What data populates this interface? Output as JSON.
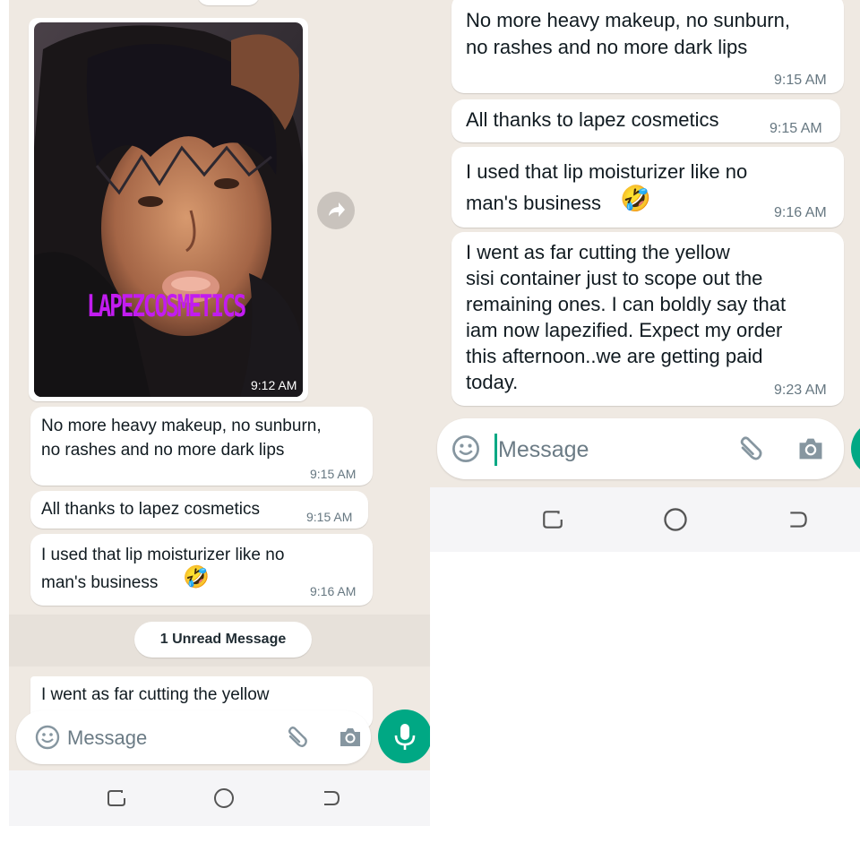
{
  "left": {
    "photo": {
      "watermark": "LAPEZCOSMETICS",
      "time": "9:12 AM"
    },
    "messages": [
      {
        "text": "No more heavy makeup, no sunburn,\nno rashes and no more dark lips",
        "time": "9:15 AM"
      },
      {
        "text": "All thanks to lapez cosmetics",
        "time": "9:15 AM"
      },
      {
        "text": "I used that lip moisturizer like no\nman's business",
        "time": "9:16 AM"
      }
    ],
    "unread_label": "1 Unread Message",
    "partial_message": "I went as far cutting the yellow",
    "input_placeholder": "Message"
  },
  "right": {
    "messages": [
      {
        "text": "No more heavy makeup, no sunburn,\nno rashes and no more dark lips",
        "time": "9:15 AM"
      },
      {
        "text": "All thanks to lapez cosmetics",
        "time": "9:15 AM"
      },
      {
        "text": "I used that lip moisturizer like no\nman's business",
        "time": "9:16 AM"
      },
      {
        "text": "I went as far cutting the yellow\nsisi container just to scope out the\nremaining ones. I can boldly say that\niam now lapezified. Expect my order\nthis afternoon..we are getting paid\ntoday.",
        "time": "9:23 AM"
      }
    ],
    "input_placeholder": "Message"
  },
  "emoji": "🤣",
  "colors": {
    "chat_bg": "#efe9e2",
    "accent_green": "#00a884",
    "watermark": "#c21cf0"
  },
  "icons": [
    "forward-icon",
    "emoji-icon",
    "attach-icon",
    "camera-icon",
    "mic-icon",
    "recents-icon",
    "home-icon",
    "back-icon"
  ]
}
